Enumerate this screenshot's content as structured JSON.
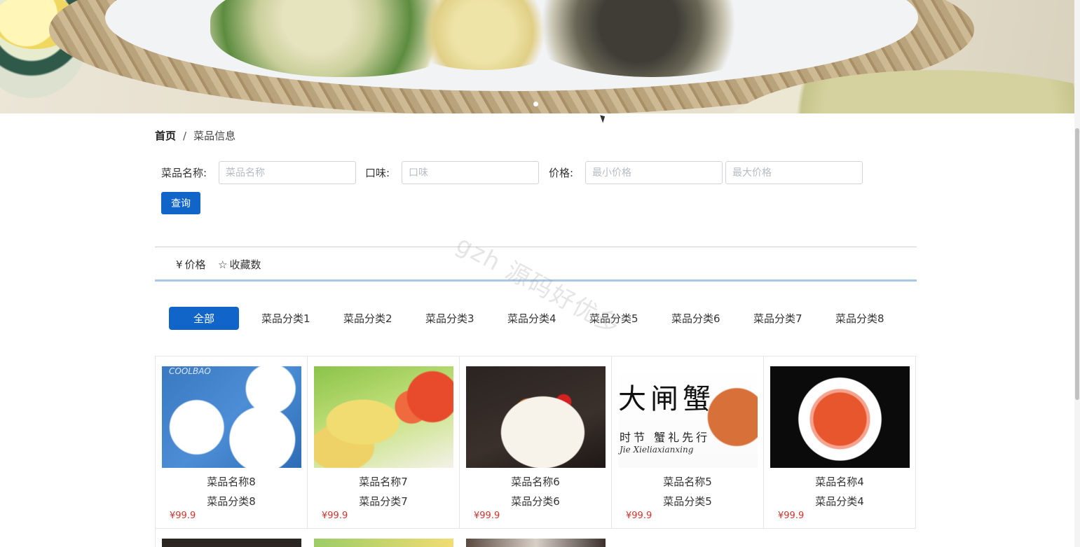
{
  "breadcrumb": {
    "home": "首页",
    "separator": "/",
    "current": "菜品信息"
  },
  "search": {
    "name_label": "菜品名称:",
    "name_placeholder": "菜品名称",
    "taste_label": "口味:",
    "taste_placeholder": "口味",
    "price_label": "价格:",
    "min_price_placeholder": "最小价格",
    "max_price_placeholder": "最大价格",
    "query_button": "查询"
  },
  "sort": [
    {
      "icon": "yen-icon",
      "glyph": "¥",
      "label": "价格"
    },
    {
      "icon": "star-outline-icon",
      "glyph": "☆",
      "label": "收藏数"
    }
  ],
  "categories": [
    "全部",
    "菜品分类1",
    "菜品分类2",
    "菜品分类3",
    "菜品分类4",
    "菜品分类5",
    "菜品分类6",
    "菜品分类7",
    "菜品分类8"
  ],
  "active_category": "全部",
  "dishes": [
    {
      "name": "菜品名称8",
      "category": "菜品分类8",
      "price": "¥99.9",
      "image_text": [
        "COOLBAO"
      ]
    },
    {
      "name": "菜品名称7",
      "category": "菜品分类7",
      "price": "¥99.9",
      "image_text": []
    },
    {
      "name": "菜品名称6",
      "category": "菜品分类6",
      "price": "¥99.9",
      "image_text": []
    },
    {
      "name": "菜品名称5",
      "category": "菜品分类5",
      "price": "¥99.9",
      "image_text": [
        "大闸蟹",
        "时节 蟹礼先行",
        "Jie Xieliaxianxing"
      ]
    },
    {
      "name": "菜品名称4",
      "category": "菜品分类4",
      "price": "¥99.9",
      "image_text": []
    }
  ],
  "watermark": "gzh 源码好优多",
  "colors": {
    "primary": "#1265c8",
    "price": "#d0342c",
    "sort_underline": "#a9c7e6"
  }
}
